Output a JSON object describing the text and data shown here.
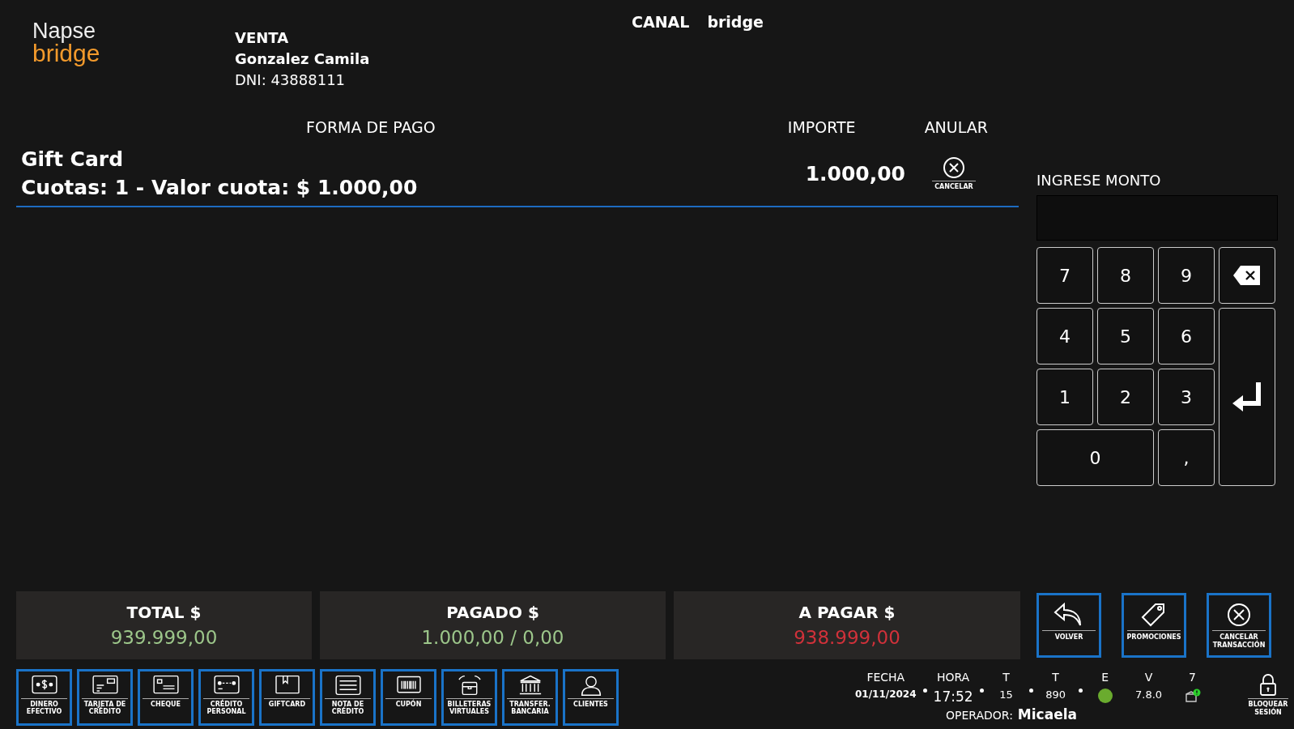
{
  "logo": {
    "line1": "Napse",
    "line2": "bridge"
  },
  "sale": {
    "type": "VENTA",
    "customer": "Gonzalez Camila",
    "dni": "DNI: 43888111"
  },
  "channel": {
    "label": "CANAL",
    "value": "bridge"
  },
  "payments": {
    "columns": [
      "FORMA DE PAGO",
      "IMPORTE",
      "ANULAR"
    ],
    "rows": [
      {
        "method": "Gift Card",
        "detail": "Cuotas: 1 - Valor cuota: $ 1.000,00",
        "amount": "1.000,00",
        "cancel": "CANCELAR"
      }
    ]
  },
  "amount_entry": {
    "label": "INGRESE MONTO"
  },
  "keypad": [
    {
      "kind": "digit",
      "label": "7"
    },
    {
      "kind": "digit",
      "label": "8"
    },
    {
      "kind": "digit",
      "label": "9"
    },
    {
      "kind": "backspace"
    },
    {
      "kind": "digit",
      "label": "4"
    },
    {
      "kind": "digit",
      "label": "5"
    },
    {
      "kind": "digit",
      "label": "6"
    },
    {
      "kind": "enter"
    },
    {
      "kind": "digit",
      "label": "1"
    },
    {
      "kind": "digit",
      "label": "2"
    },
    {
      "kind": "digit",
      "label": "3"
    },
    {
      "kind": "wide",
      "label": "0"
    },
    {
      "kind": "digit",
      "label": ","
    }
  ],
  "totals": [
    {
      "label": "TOTAL $",
      "value": "939.999,00",
      "color": "#9cc68a"
    },
    {
      "label": "PAGADO $",
      "value": "1.000,00 / 0,00",
      "color": "#9cc68a"
    },
    {
      "label": "A PAGAR $",
      "value": "938.999,00",
      "color": "#d0313a"
    }
  ],
  "actions": [
    {
      "label": "VOLVER"
    },
    {
      "label": "PROMOCIONES"
    },
    {
      "label": "CANCELAR TRANSACCIÓN"
    }
  ],
  "payment_methods": [
    {
      "label": "DINERO EFECTIVO"
    },
    {
      "label": "TARJETA DE CRÉDITO"
    },
    {
      "label": "CHEQUE"
    },
    {
      "label": "CRÉDITO PERSONAL"
    },
    {
      "label": "GIFTCARD"
    },
    {
      "label": "NOTA DE CRÉDITO"
    },
    {
      "label": "CUPÓN"
    },
    {
      "label": "BILLETERAS VIRTUALES"
    },
    {
      "label": "TRANSFER. BANCARIA"
    },
    {
      "label": "CLIENTES"
    }
  ],
  "status_bar": {
    "items": [
      {
        "label": "FECHA",
        "value": "01/11/2024",
        "kind": "date"
      },
      {
        "label": "HORA",
        "value": "17:52",
        "kind": "text"
      },
      {
        "label": "T",
        "value": "15",
        "kind": "text"
      },
      {
        "label": "T",
        "value": "890",
        "kind": "text"
      },
      {
        "label": "E",
        "kind": "dot",
        "color": "#6aab2e"
      },
      {
        "label": "V",
        "value": "7.8.0",
        "kind": "text"
      },
      {
        "label": "7",
        "kind": "package"
      }
    ],
    "operator_label": "OPERADOR:",
    "operator": "Micaela",
    "lock": "BLOQUEAR SESIÓN"
  }
}
